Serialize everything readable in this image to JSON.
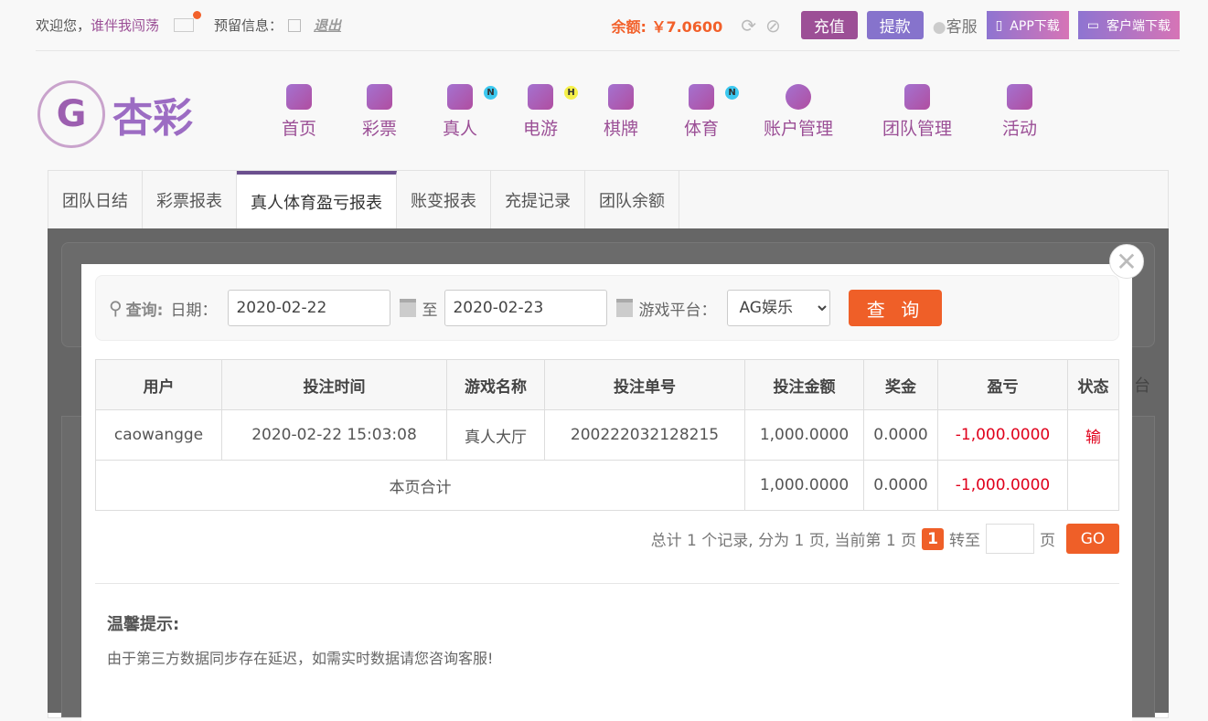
{
  "top": {
    "welcome": "欢迎您，",
    "username": "谁伴我闯荡",
    "reserve_info": "预留信息：",
    "logout": "退出",
    "balance": "余额: ￥7.0600",
    "recharge": "充值",
    "withdraw": "提款",
    "service": "客服",
    "app_download": "APP下载",
    "client_download": "客户端下载"
  },
  "logo": {
    "text": "杏彩"
  },
  "nav": [
    {
      "label": "首页"
    },
    {
      "label": "彩票"
    },
    {
      "label": "真人",
      "badge": "N"
    },
    {
      "label": "电游",
      "badge": "H"
    },
    {
      "label": "棋牌"
    },
    {
      "label": "体育",
      "badge": "N"
    },
    {
      "label": "账户管理"
    },
    {
      "label": "团队管理"
    },
    {
      "label": "活动"
    }
  ],
  "tabs": [
    "团队日结",
    "彩票报表",
    "真人体育盈亏报表",
    "账变报表",
    "充提记录",
    "团队余额"
  ],
  "bg_text": "台",
  "search": {
    "label": "查询:",
    "date_label": "日期：",
    "start": "2020-02-22",
    "to": "至",
    "end": "2020-02-23",
    "platform_label": "游戏平台：",
    "platform": "AG娱乐",
    "button": "查 询"
  },
  "table": {
    "headers": [
      "用户",
      "投注时间",
      "游戏名称",
      "投注单号",
      "投注金额",
      "奖金",
      "盈亏",
      "状态"
    ],
    "rows": [
      [
        "caowangge",
        "2020-02-22 15:03:08",
        "真人大厅",
        "200222032128215",
        "1,000.0000",
        "0.0000",
        "-1,000.0000",
        "输"
      ]
    ],
    "subtotal": {
      "label": "本页合计",
      "amount": "1,000.0000",
      "bonus": "0.0000",
      "profit": "-1,000.0000"
    }
  },
  "pager": {
    "summary": "总计 1 个记录, 分为 1 页, 当前第 1 页",
    "current": "1",
    "goto": "转至",
    "page": "页",
    "go": "GO"
  },
  "tip": {
    "title": "温馨提示:",
    "text": "由于第三方数据同步存在延迟，如需实时数据请您咨询客服!"
  }
}
